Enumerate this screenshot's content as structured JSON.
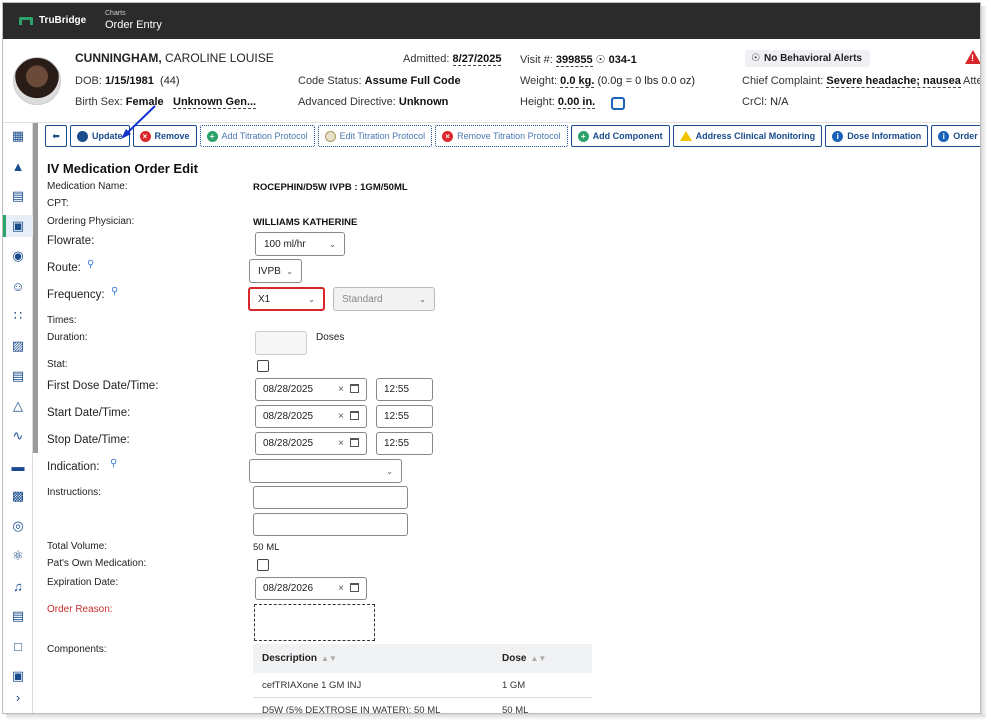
{
  "app": {
    "brand": "TruBridge",
    "breadcrumb_parent": "Charts",
    "breadcrumb_current": "Order Entry"
  },
  "patient": {
    "last_name": "CUNNINGHAM,",
    "first_names": " CAROLINE LOUISE",
    "dob_label": "DOB:",
    "dob": "1/15/1981",
    "age": "(44)",
    "birth_sex_label": "Birth Sex:",
    "birth_sex": "Female",
    "gender": "Unknown Gen...",
    "admitted_label": "Admitted:",
    "admitted": "8/27/2025",
    "code_status_label": "Code Status:",
    "code_status": "Assume Full Code",
    "adv_directive_label": "Advanced Directive:",
    "adv_directive": "Unknown",
    "visit_label": "Visit #:",
    "visit": "399855",
    "room": "034-1",
    "weight_label": "Weight:",
    "weight": "0.0 kg.",
    "weight_detail": "(0.0g = 0 lbs 0.0 oz)",
    "height_label": "Height:",
    "height": "0.00 in.",
    "behavioral_alert": "No Behavioral Alerts",
    "chief_complaint_label": "Chief Complaint:",
    "chief_complaint": "Severe headache; nausea",
    "crcl_label": "CrCl:",
    "crcl": "N/A",
    "att_label": "Atte"
  },
  "toolbar": {
    "update": "Update",
    "remove": "Remove",
    "add_titration": "Add Titration Protocol",
    "edit_titration": "Edit Titration Protocol",
    "remove_titration": "Remove Titration Protocol",
    "add_component": "Add Component",
    "address_monitoring": "Address Clinical Monitoring",
    "dose_info": "Dose Information",
    "order_reason": "Order Reason"
  },
  "form": {
    "title": "IV Medication Order Edit",
    "medication_name_label": "Medication Name:",
    "medication_name": "ROCEPHIN/D5W IVPB : 1GM/50ML",
    "cpt_label": "CPT:",
    "ordering_physician_label": "Ordering Physician:",
    "ordering_physician": "WILLIAMS KATHERINE",
    "flowrate_label": "Flowrate:",
    "flowrate": "100 ml/hr",
    "route_label": "Route:",
    "route": "IVPB",
    "frequency_label": "Frequency:",
    "frequency": "X1",
    "frequency_type": "Standard",
    "times_label": "Times:",
    "duration_label": "Duration:",
    "duration_value": "",
    "duration_unit": "Doses",
    "stat_label": "Stat:",
    "first_dose_label": "First Dose Date/Time:",
    "first_dose_date": "08/28/2025",
    "first_dose_time": "12:55",
    "start_label": "Start Date/Time:",
    "start_date": "08/28/2025",
    "start_time": "12:55",
    "stop_label": "Stop Date/Time:",
    "stop_date": "08/28/2025",
    "stop_time": "12:55",
    "indication_label": "Indication:",
    "indication": "",
    "instructions_label": "Instructions:",
    "total_volume_label": "Total Volume:",
    "total_volume": "50 ML",
    "pats_own_label": "Pat's Own Medication:",
    "expiration_label": "Expiration Date:",
    "expiration_date": "08/28/2026",
    "order_reason_label": "Order Reason:",
    "components_label": "Components:"
  },
  "components": {
    "headers": [
      "Description",
      "Dose"
    ],
    "rows": [
      [
        "cefTRIAXone 1 GM INJ",
        "1 GM"
      ],
      [
        "D5W (5% DEXTROSE IN WATER); 50 ML",
        "50 ML"
      ]
    ]
  },
  "colors": {
    "brand_green": "#2ca36a",
    "nav_blue": "#1a4c8c",
    "alert_red": "#d9262b"
  }
}
